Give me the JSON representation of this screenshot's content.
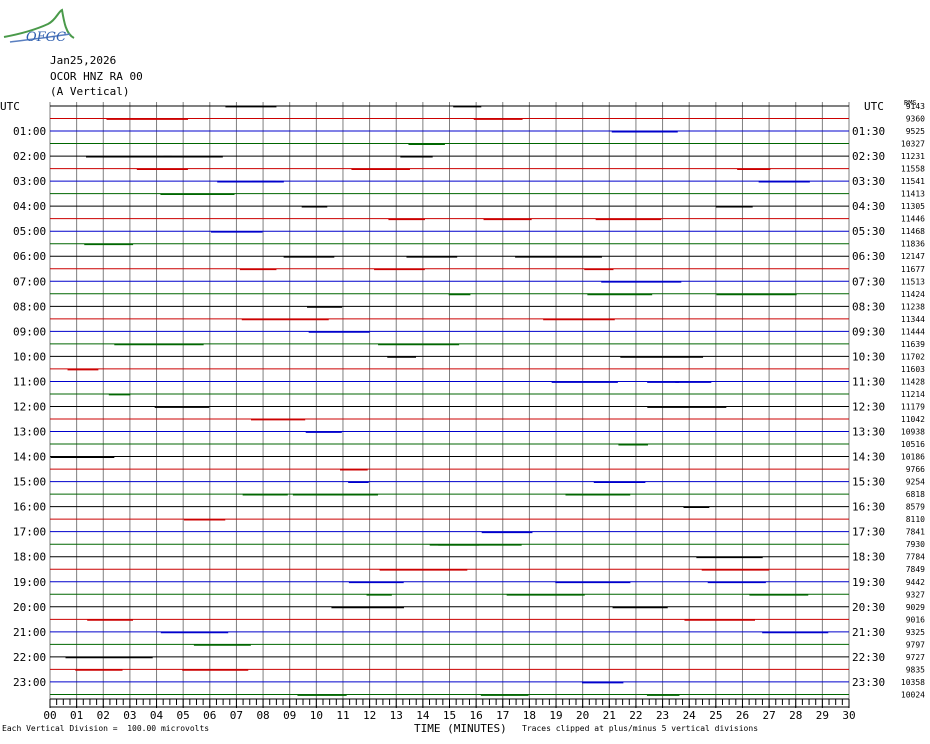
{
  "logo_text": "OFGC",
  "header": {
    "date": "Jan25,2026",
    "station": "OCOR HNZ RA 00",
    "component": "(A Vertical)"
  },
  "utc_left": "UTC",
  "utc_right": "UTC",
  "scale_label": "RMS",
  "footer": {
    "division_note": "Each Vertical Division =  100.00 microvolts",
    "xlabel": "TIME (MINUTES)",
    "clip_note": "Traces clipped at plus/minus 5 vertical divisions"
  },
  "colors": {
    "black": "#000000",
    "red": "#cc0000",
    "blue": "#0000cc",
    "green": "#006600",
    "grid": "#7f7f7f"
  },
  "chart_data": {
    "type": "line",
    "title": "OCOR HNZ RA 00 (A Vertical) Jan25,2026",
    "xlabel": "TIME (MINUTES)",
    "xlim": [
      0,
      30
    ],
    "x_ticks": [
      "00",
      "01",
      "02",
      "03",
      "04",
      "05",
      "06",
      "07",
      "08",
      "09",
      "10",
      "11",
      "12",
      "13",
      "14",
      "15",
      "16",
      "17",
      "18",
      "19",
      "20",
      "21",
      "22",
      "23",
      "24",
      "25",
      "26",
      "27",
      "28",
      "29",
      "30"
    ],
    "trace_color_cycle": [
      "black",
      "red",
      "blue",
      "green"
    ],
    "hour_labels_left": [
      "",
      "01:00",
      "02:00",
      "03:00",
      "04:00",
      "05:00",
      "06:00",
      "07:00",
      "08:00",
      "09:00",
      "10:00",
      "11:00",
      "12:00",
      "13:00",
      "14:00",
      "15:00",
      "16:00",
      "17:00",
      "18:00",
      "19:00",
      "20:00",
      "21:00",
      "22:00",
      "23:00"
    ],
    "halfhour_labels_right": [
      "",
      "01:30",
      "02:30",
      "03:30",
      "04:30",
      "05:30",
      "06:30",
      "07:30",
      "08:30",
      "09:30",
      "10:30",
      "11:30",
      "12:30",
      "13:30",
      "14:30",
      "15:30",
      "16:30",
      "17:30",
      "18:30",
      "19:30",
      "20:30",
      "21:30",
      "22:30",
      "23:30"
    ],
    "rms_values": [
      "9143",
      "9360",
      "9525",
      "10327",
      "11231",
      "11558",
      "11541",
      "11413",
      "11305",
      "11446",
      "11468",
      "11836",
      "12147",
      "11677",
      "11513",
      "11424",
      "11238",
      "11344",
      "11444",
      "11639",
      "11702",
      "11603",
      "11428",
      "11214",
      "11179",
      "11042",
      "10938",
      "10516",
      "10186",
      "9766",
      "9254",
      "6818",
      "8579",
      "8110",
      "7841",
      "7930",
      "7784",
      "7849",
      "9442",
      "9327",
      "9029",
      "9016",
      "9325",
      "9797",
      "9727",
      "9835",
      "10358",
      "10024"
    ],
    "units": "100.00 microvolts per vertical division"
  }
}
